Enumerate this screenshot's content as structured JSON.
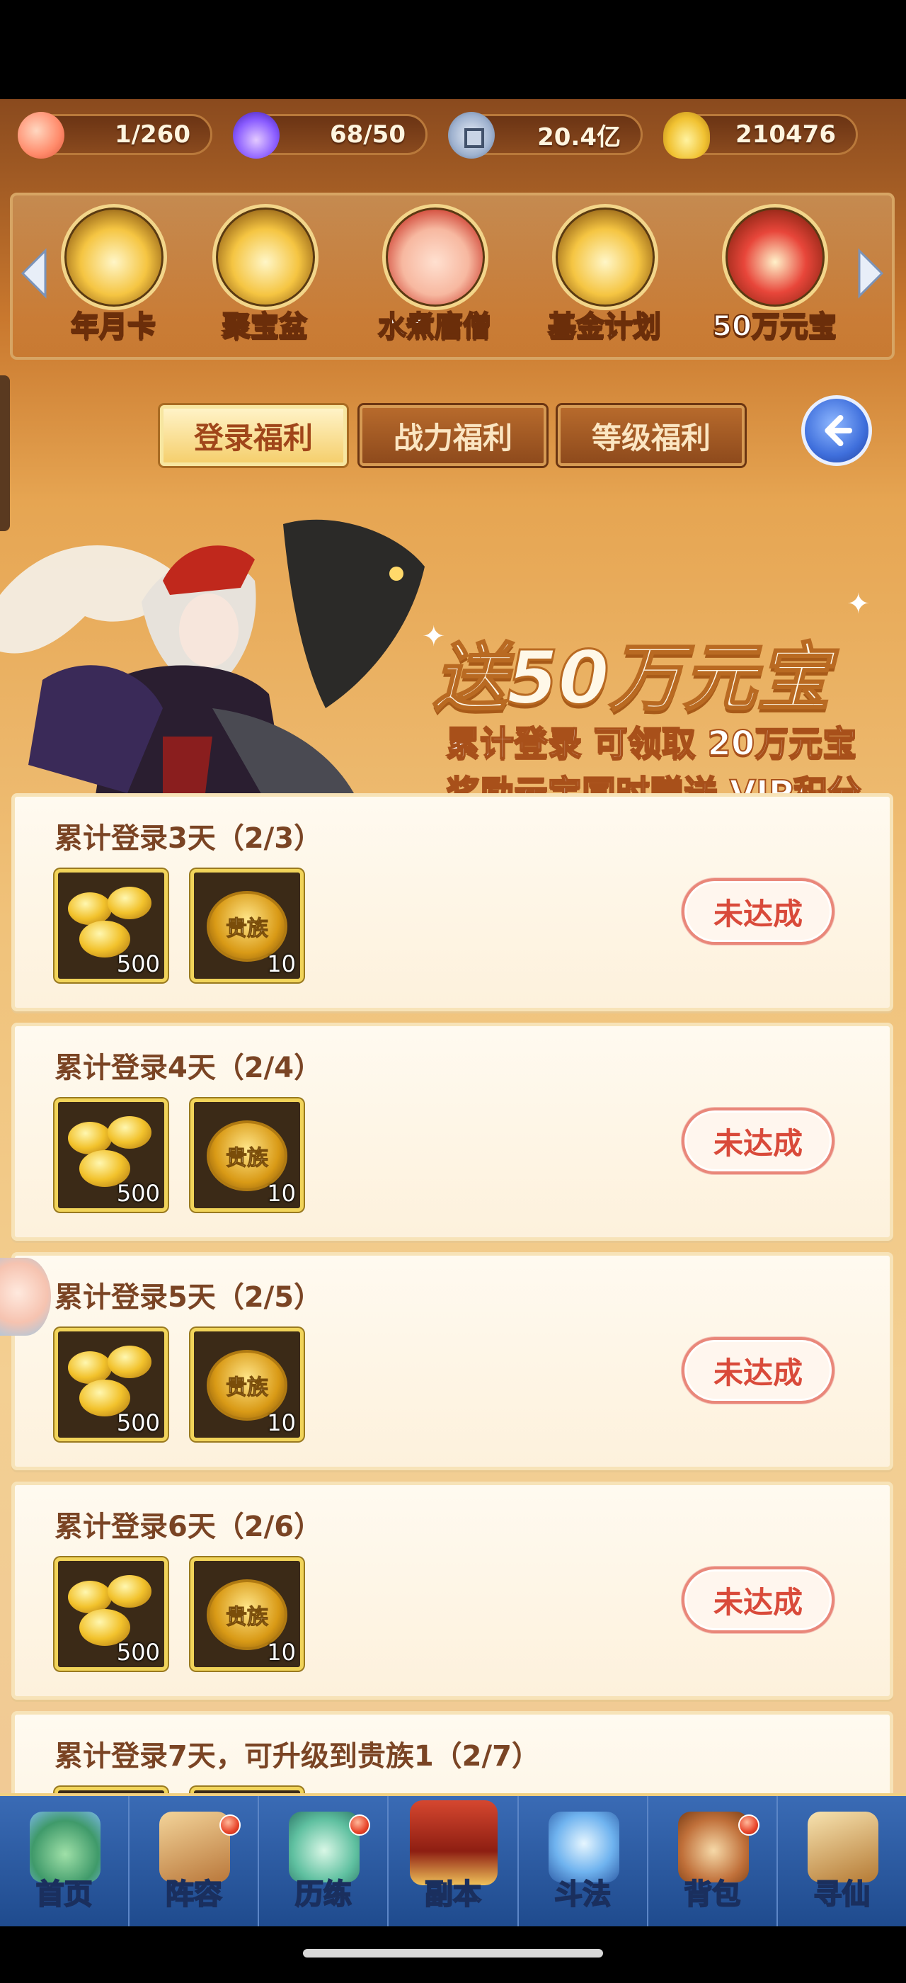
{
  "resources": [
    {
      "icon": "peach-icon",
      "value": "1/260"
    },
    {
      "icon": "spirit-flame-icon",
      "value": "68/50"
    },
    {
      "icon": "copper-coin-icon",
      "value": "20.4亿"
    },
    {
      "icon": "gold-ingot-icon",
      "value": "210476"
    }
  ],
  "activities": [
    {
      "label": "年月卡"
    },
    {
      "label": "聚宝盆"
    },
    {
      "label": "水煮唐僧"
    },
    {
      "label": "基金计划"
    },
    {
      "label": "50万元宝"
    }
  ],
  "tabs": [
    {
      "label": "登录福利",
      "active": true
    },
    {
      "label": "战力福利",
      "active": false
    },
    {
      "label": "等级福利",
      "active": false
    }
  ],
  "banner": {
    "title": "送50万元宝",
    "line1": "累计登录 可领取 20万元宝",
    "line2": "奖励元宝同时赠送 VIP积分"
  },
  "tasks": [
    {
      "title": "累计登录3天（2/3）",
      "rewards": [
        {
          "type": "gold-ingot",
          "count": "500"
        },
        {
          "type": "noble-badge",
          "label": "贵族",
          "count": "10"
        }
      ],
      "status": "未达成"
    },
    {
      "title": "累计登录4天（2/4）",
      "rewards": [
        {
          "type": "gold-ingot",
          "count": "500"
        },
        {
          "type": "noble-badge",
          "label": "贵族",
          "count": "10"
        }
      ],
      "status": "未达成"
    },
    {
      "title": "累计登录5天（2/5）",
      "rewards": [
        {
          "type": "gold-ingot",
          "count": "500"
        },
        {
          "type": "noble-badge",
          "label": "贵族",
          "count": "10"
        }
      ],
      "status": "未达成"
    },
    {
      "title": "累计登录6天（2/6）",
      "rewards": [
        {
          "type": "gold-ingot",
          "count": "500"
        },
        {
          "type": "noble-badge",
          "label": "贵族",
          "count": "10"
        }
      ],
      "status": "未达成"
    },
    {
      "title": "累计登录7天，可升级到贵族1（2/7）"
    }
  ],
  "nav": [
    {
      "label": "首页",
      "icon": "home-icon",
      "badge": false
    },
    {
      "label": "阵容",
      "icon": "lineup-icon",
      "badge": true
    },
    {
      "label": "历练",
      "icon": "training-icon",
      "badge": true
    },
    {
      "label": "副本",
      "icon": "dungeon-icon",
      "badge": false
    },
    {
      "label": "斗法",
      "icon": "battle-icon",
      "badge": false
    },
    {
      "label": "背包",
      "icon": "backpack-icon",
      "badge": true
    },
    {
      "label": "寻仙",
      "icon": "seek-immortal-icon",
      "badge": false
    }
  ],
  "colors": {
    "accent": "#d94a3a",
    "card_title": "#7a4424",
    "nav_bg": "#2a5aa3"
  }
}
